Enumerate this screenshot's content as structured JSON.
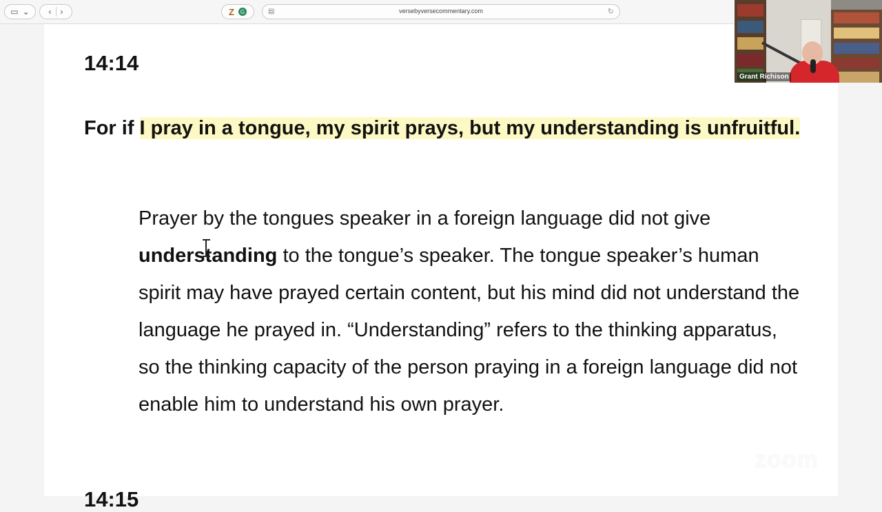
{
  "browser": {
    "url": "versebyversecommentary.com",
    "icons": {
      "sidebar": "sidebar-icon",
      "back": "chevron-left-icon",
      "forward": "chevron-right-icon",
      "reload": "reload-icon"
    }
  },
  "content": {
    "verse_ref": "14:14",
    "verse_lead": "For if ",
    "verse_highlight": "I pray in a tongue, my spirit prays, but my understanding is unfruitful.",
    "commentary": {
      "part1": "Prayer by the tongues speaker in a foreign language did not give ",
      "bold": "understanding",
      "part2": " to the tongue’s speaker. The tongue speaker’s human spirit may have prayed certain content, but his mind did not understand the language he prayed in. “Understanding” refers to the thinking apparatus, so the thinking capacity of the person praying in a foreign language did not enable him to understand his own prayer."
    },
    "next_ref": "14:15"
  },
  "video": {
    "participant_name": "Grant Richison"
  },
  "watermark": "zoom"
}
